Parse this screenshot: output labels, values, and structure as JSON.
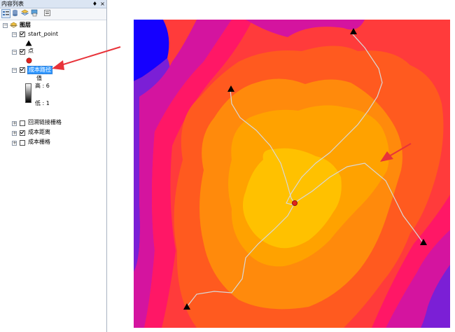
{
  "panel": {
    "title": "内容列表",
    "pin": "♦",
    "close": "×"
  },
  "toolbar": {
    "buttons": [
      "list-by-drawing-order",
      "list-by-source",
      "list-by-visibility",
      "list-by-selection",
      "options"
    ]
  },
  "tree": {
    "root_label": "图层",
    "layers": [
      {
        "label": "start_point",
        "checked": true,
        "expanded": true
      },
      {
        "label": "点",
        "checked": true,
        "expanded": true
      },
      {
        "label": "成本路径",
        "checked": true,
        "expanded": true,
        "selected": true,
        "legend": {
          "heading": "值",
          "high": "高 : 6",
          "low": "低 : 1"
        }
      },
      {
        "label": "回溯链接栅格",
        "checked": false,
        "expanded": false
      },
      {
        "label": "成本距离",
        "checked": true,
        "expanded": false
      },
      {
        "label": "成本栅格",
        "checked": false,
        "expanded": false
      }
    ]
  },
  "colors": {
    "blue": "#1500ff",
    "violet": "#7b1fd6",
    "magenta": "#d4149f",
    "pink": "#ff1766",
    "red": "#ff3b3b",
    "orange_red": "#ff5a1f",
    "orange": "#ff8a0c",
    "amber": "#ffa200",
    "gold": "#ffc100",
    "annotation_arrow": "#e8333a",
    "point_marker": "#e0221c",
    "path_line": "#d8d8d8"
  }
}
